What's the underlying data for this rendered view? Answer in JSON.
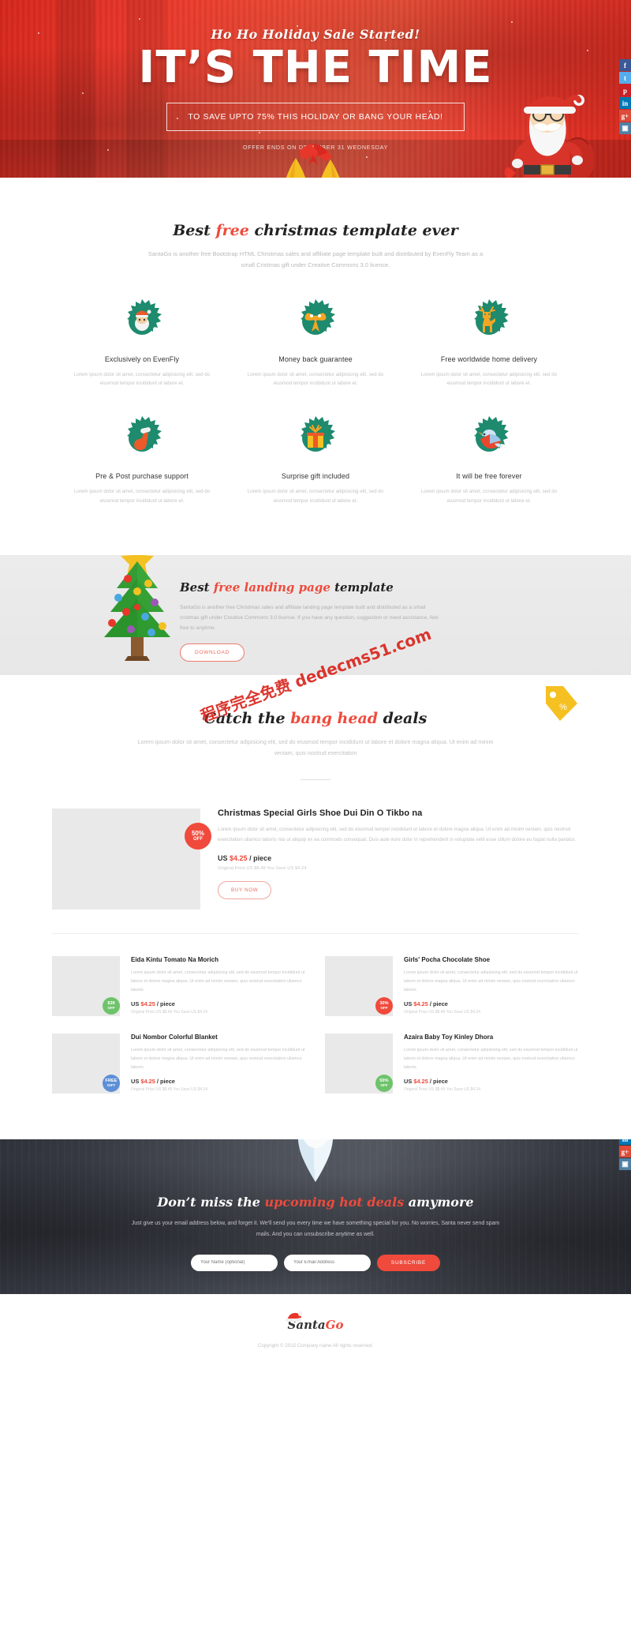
{
  "hero": {
    "eyebrow": "Ho Ho Holiday Sale Started!",
    "title": "IT’S THE TIME",
    "cta": "TO SAVE UPTO 75% THIS HOLIDAY OR BANG YOUR HEAD!",
    "note": "OFFER ENDS ON DECEMBER 31 WEDNESDAY"
  },
  "social": [
    {
      "name": "facebook",
      "glyph": "f",
      "color": "#3b5998"
    },
    {
      "name": "twitter",
      "glyph": "t",
      "color": "#55acee"
    },
    {
      "name": "pinterest",
      "glyph": "p",
      "color": "#cb2027"
    },
    {
      "name": "linkedin",
      "glyph": "in",
      "color": "#0077b5"
    },
    {
      "name": "googleplus",
      "glyph": "g+",
      "color": "#dd4b39"
    },
    {
      "name": "instagram",
      "glyph": "▣",
      "color": "#517fa4"
    }
  ],
  "features": {
    "title_pre": "Best ",
    "title_hl": "free",
    "title_post": " christmas template ever",
    "subtitle": "SantaGo is another free Bootstrap HTML Christmas sales and affiliate page template built and distributed by EvenFly Team as a small Cristmas gift under Creative Commons 3.0 licence.",
    "items": [
      {
        "icon": "santa-wreath-icon",
        "title": "Exclusively on EvenFly",
        "text": "Lorem ipsum dolor sit amet, consectetur adipisicing elit, sed do eiusmod tempor incididunt ut labore et."
      },
      {
        "icon": "bow-wreath-icon",
        "title": "Money back guarantee",
        "text": "Lorem ipsum dolor sit amet, consectetur adipisicing elit, sed do eiusmod tempor incididunt ut labore et."
      },
      {
        "icon": "reindeer-wreath-icon",
        "title": "Free worldwide home delivery",
        "text": "Lorem ipsum dolor sit amet, consectetur adipisicing elit, sed do eiusmod tempor incididunt ut labore et."
      },
      {
        "icon": "stocking-wreath-icon",
        "title": "Pre & Post purchase support",
        "text": "Lorem ipsum dolor sit amet, consectetur adipisicing elit, sed do eiusmod tempor incididunt ut labore et."
      },
      {
        "icon": "gift-wreath-icon",
        "title": "Surprise gift included",
        "text": "Lorem ipsum dolor sit amet, consectetur adipisicing elit, sed do eiusmod tempor incididunt ut labore et."
      },
      {
        "icon": "bird-wreath-icon",
        "title": "It will be free forever",
        "text": "Lorem ipsum dolor sit amet, consectetur adipisicing elit, sed do eiusmod tempor incididunt ut labore et."
      }
    ]
  },
  "landing": {
    "title_pre": "Best ",
    "title_hl": "free landing page",
    "title_post": " template",
    "text": "SantaGo is another free Christmas sales and affiliate landing page template built and distributed as a small cristmas gift under Creative Commons 3.0 license. If you have any question, suggestion or need assistance, feel free to anytime.",
    "button": "DOWNLOAD"
  },
  "deals": {
    "title_pre": "Catch the ",
    "title_hl": "bang head",
    "title_post": " deals",
    "subtitle": "Lorem ipsum dolor sit amet, consectetur adipisicing elit, sed do eiusmod tempor incididunt ut labore et dolore magna aliqua. Ut enim ad minim veniam, quis nostrud exercitation",
    "watermark": "程序完全免费 dedecms51.com",
    "featured": {
      "badge_top": "50%",
      "badge_bottom": "OFF",
      "title": "Christmas Special Girls Shoe Dui Din O Tikbo na",
      "text": "Lorem ipsum dolor sit amet, consectetur adipisicing elit, sed do eiusmod tempor incididunt ut labore et dolore magna aliqua. Ut enim ad minim veniam, quis nostrud exercitation ullamco laboris nisi ut aliquip ex ea commodo consequat. Duis aute irure dolor in reprehenderit in voluptate velit esse cillum dolore eu fugiat nulla pariatur.",
      "price_currency": "US",
      "price_amount": "$4.25",
      "price_unit": "/ piece",
      "price_sub": "Original Price US $8.49   You Save US $4.24",
      "button": "BUY NOW"
    },
    "grid": [
      {
        "badge_top": "$39",
        "badge_bottom": "OFF",
        "badge_color": "#6ec36a",
        "title": "Eida Kintu Tomato Na Morich",
        "text": "Lorem ipsum dolor sit amet, consectetur adipisicing elit, sed do eiusmod tempor incididunt ut labore et dolore magna aliqua. Ut enim ad minim veniam, quis nostrud exercitation ullamco laboris",
        "price_currency": "US",
        "price_amount": "$4.25",
        "price_unit": "/ piece",
        "price_sub": "Original Price US $8.49   You Save US $4.24"
      },
      {
        "badge_top": "30%",
        "badge_bottom": "OFF",
        "badge_color": "#f04a3c",
        "title": "Girls' Pocha Chocolate Shoe",
        "text": "Lorem ipsum dolor sit amet, consectetur adipisicing elit, sed do eiusmod tempor incididunt ut labore et dolore magna aliqua. Ut enim ad minim veniam, quis nostrud exercitation ullamco laboris",
        "price_currency": "US",
        "price_amount": "$4.25",
        "price_unit": "/ piece",
        "price_sub": "Original Price US $8.49   You Save US $4.24"
      },
      {
        "badge_top": "FREE",
        "badge_bottom": "GIFT",
        "badge_color": "#5d8fd6",
        "title": "Dui Nombor Colorful Blanket",
        "text": "Lorem ipsum dolor sit amet, consectetur adipisicing elit, sed do eiusmod tempor incididunt ut labore et dolore magna aliqua. Ut enim ad minim veniam, quis nostrud exercitation ullamco laboris",
        "price_currency": "US",
        "price_amount": "$4.25",
        "price_unit": "/ piece",
        "price_sub": "Original Price US $8.49   You Save US $4.24"
      },
      {
        "badge_top": "50%",
        "badge_bottom": "OFF",
        "badge_color": "#6ec36a",
        "title": "Azaira Baby Toy Kinley Dhora",
        "text": "Lorem ipsum dolor sit amet, consectetur adipisicing elit, sed do eiusmod tempor incididunt ut labore et dolore magna aliqua. Ut enim ad minim veniam, quis nostrud exercitation ullamco laboris",
        "price_currency": "US",
        "price_amount": "$4.25",
        "price_unit": "/ piece",
        "price_sub": "Original Price US $8.49   You Save US $4.24"
      }
    ]
  },
  "newsletter": {
    "title_pre": "Don’t miss the ",
    "title_hl": "upcoming hot deals",
    "title_post": " amymore",
    "text": "Just give us your email address below, and forget it. We'll send you every time we have something special for you. No worries, Santa never send spam mails. And you can unsubscribe anytime as well.",
    "name_placeholder": "Your Name (optional)",
    "email_placeholder": "Your Email Address",
    "button": "SUBSCRIBE"
  },
  "footer": {
    "logo_a": "Santa",
    "logo_b": "Go",
    "copyright": "Copyright © 2015 Company name All rights reserved."
  },
  "colors": {
    "brand_red": "#ef4a3c",
    "hero_red": "#e8362a",
    "wreath_green": "#1e8a6e",
    "dark": "#3b3e46"
  }
}
